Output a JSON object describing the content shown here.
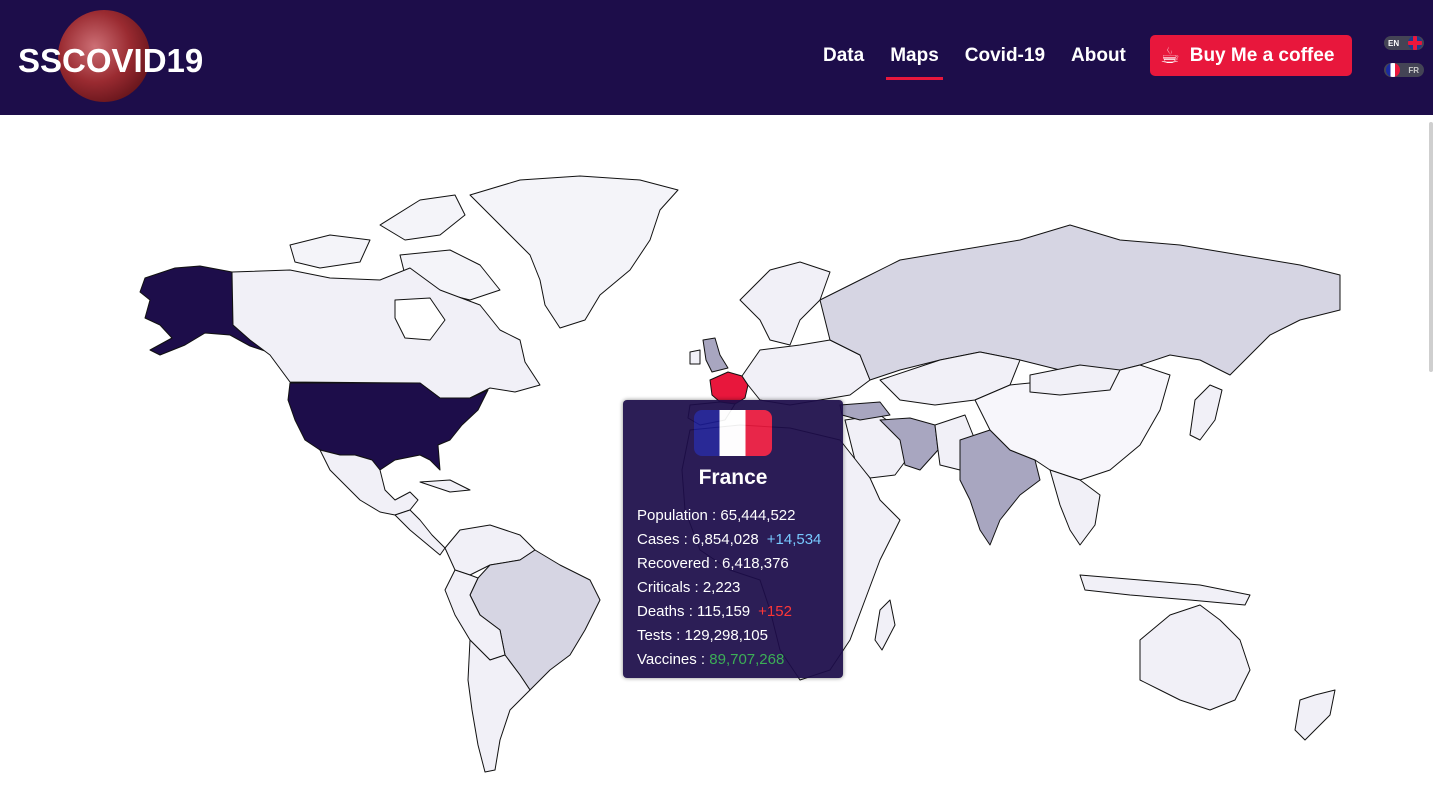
{
  "logo": {
    "text": "SSCOVID19"
  },
  "nav": {
    "items": [
      {
        "label": "Data",
        "active": false
      },
      {
        "label": "Maps",
        "active": true
      },
      {
        "label": "Covid-19",
        "active": false
      },
      {
        "label": "About",
        "active": false
      }
    ]
  },
  "coffee": {
    "icon": "coffee-cup-icon",
    "label": "Buy Me a coffee"
  },
  "languages": {
    "en": "EN",
    "fr": "FR"
  },
  "tooltip": {
    "country": "France",
    "population_label": "Population : ",
    "population": "65,444,522",
    "cases_label": "Cases : ",
    "cases": "6,854,028",
    "cases_delta": "+14,534",
    "recovered_label": "Recovered : ",
    "recovered": "6,418,376",
    "criticals_label": "Criticals : ",
    "criticals": "2,223",
    "deaths_label": "Deaths : ",
    "deaths": "115,159",
    "deaths_delta": "+152",
    "tests_label": "Tests : ",
    "tests": "129,298,105",
    "vaccines_label": "Vaccines : ",
    "vaccines": "89,707,268"
  },
  "colors": {
    "header_bg": "#1d0d4a",
    "accent": "#e8173c",
    "highlight": "#e8173c",
    "scale_max": "#1d0d4a",
    "scale_high": "#a8a6c0",
    "scale_mid": "#d6d5e3",
    "scale_low": "#f1f0f7"
  }
}
